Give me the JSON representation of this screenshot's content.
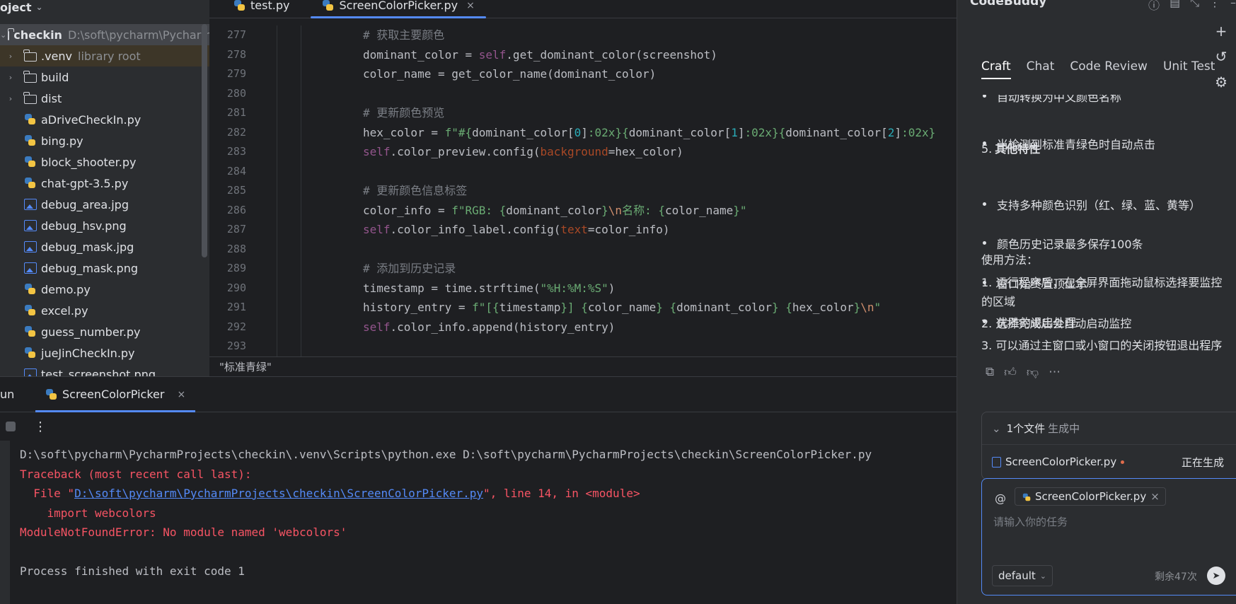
{
  "project": {
    "header_label": "oject",
    "root": {
      "name": "checkin",
      "path": "D:\\soft\\pycharm\\Pycharm"
    },
    "items": [
      {
        "name": ".venv",
        "hint": "library root",
        "type": "folder",
        "expandable": true
      },
      {
        "name": "build",
        "type": "folder",
        "expandable": true
      },
      {
        "name": "dist",
        "type": "folder",
        "expandable": true
      },
      {
        "name": "aDriveCheckIn.py",
        "type": "py"
      },
      {
        "name": "bing.py",
        "type": "py"
      },
      {
        "name": "block_shooter.py",
        "type": "py"
      },
      {
        "name": "chat-gpt-3.5.py",
        "type": "py"
      },
      {
        "name": "debug_area.jpg",
        "type": "img"
      },
      {
        "name": "debug_hsv.png",
        "type": "img"
      },
      {
        "name": "debug_mask.jpg",
        "type": "img"
      },
      {
        "name": "debug_mask.png",
        "type": "img"
      },
      {
        "name": "demo.py",
        "type": "py"
      },
      {
        "name": "excel.py",
        "type": "py"
      },
      {
        "name": "guess_number.py",
        "type": "py"
      },
      {
        "name": "jueJinCheckIn.py",
        "type": "py"
      },
      {
        "name": "test_screenshot.png",
        "type": "img"
      }
    ]
  },
  "editor": {
    "tabs": [
      {
        "label": "test.py",
        "active": false
      },
      {
        "label": "ScreenColorPicker.py",
        "active": true,
        "close": "×"
      }
    ],
    "line_numbers": [
      "277",
      "278",
      "279",
      "280",
      "281",
      "282",
      "283",
      "284",
      "285",
      "286",
      "287",
      "288",
      "289",
      "290",
      "291",
      "292",
      "293"
    ],
    "status_tip": "\"标准青绿\""
  },
  "run": {
    "label": "un",
    "tab_label": "ScreenColorPicker",
    "tab_close": "×",
    "menu_icon": "⋮",
    "console": {
      "cmd": "D:\\soft\\pycharm\\PycharmProjects\\checkin\\.venv\\Scripts\\python.exe D:\\soft\\pycharm\\PycharmProjects\\checkin\\ScreenColorPicker.py",
      "traceback": "Traceback (most recent call last):",
      "file_prefix": "  File \"",
      "file_link": "D:\\soft\\pycharm\\PycharmProjects\\checkin\\ScreenColorPicker.py",
      "file_suffix": "\", line 14, in <module>",
      "import_line": "    import webcolors",
      "error": "ModuleNotFoundError: No module named 'webcolors'",
      "exit": "Process finished with exit code 1"
    }
  },
  "buddy": {
    "title": "CodeBuddy",
    "tabs": [
      "Craft",
      "Chat",
      "Code Review",
      "Unit Test"
    ],
    "lines": {
      "cut_top": "自动转换为中文颜色名称",
      "b1": "当检测到标准青绿色时自动点击",
      "h5_num": "5.",
      "h5": "其他特性",
      "b2": "支持多种颜色识别（红、绿、蓝、黄等）",
      "b3": "颜色历史记录最多保存100条",
      "b4": "窗口始终置顶显示",
      "b5": "优雅的退出处理",
      "usage": "使用方法：",
      "step1a": "1. 运行程序后，在全屏界面拖动鼠标选择要监控",
      "step1b": "的区域",
      "step2": "2. 选择完成后会自动启动监控",
      "step3": "3. 可以通过主窗口或小窗口的关闭按钮退出程序"
    },
    "gen": {
      "title": "1个文件",
      "status": "生成中",
      "file": "ScreenColorPicker.py",
      "file_state": "正在生成"
    },
    "input": {
      "at": "@",
      "chip": "ScreenColorPicker.py",
      "chip_close": "×",
      "placeholder": "请输入你的任务",
      "model": "default",
      "remaining": "剩余47次"
    }
  }
}
